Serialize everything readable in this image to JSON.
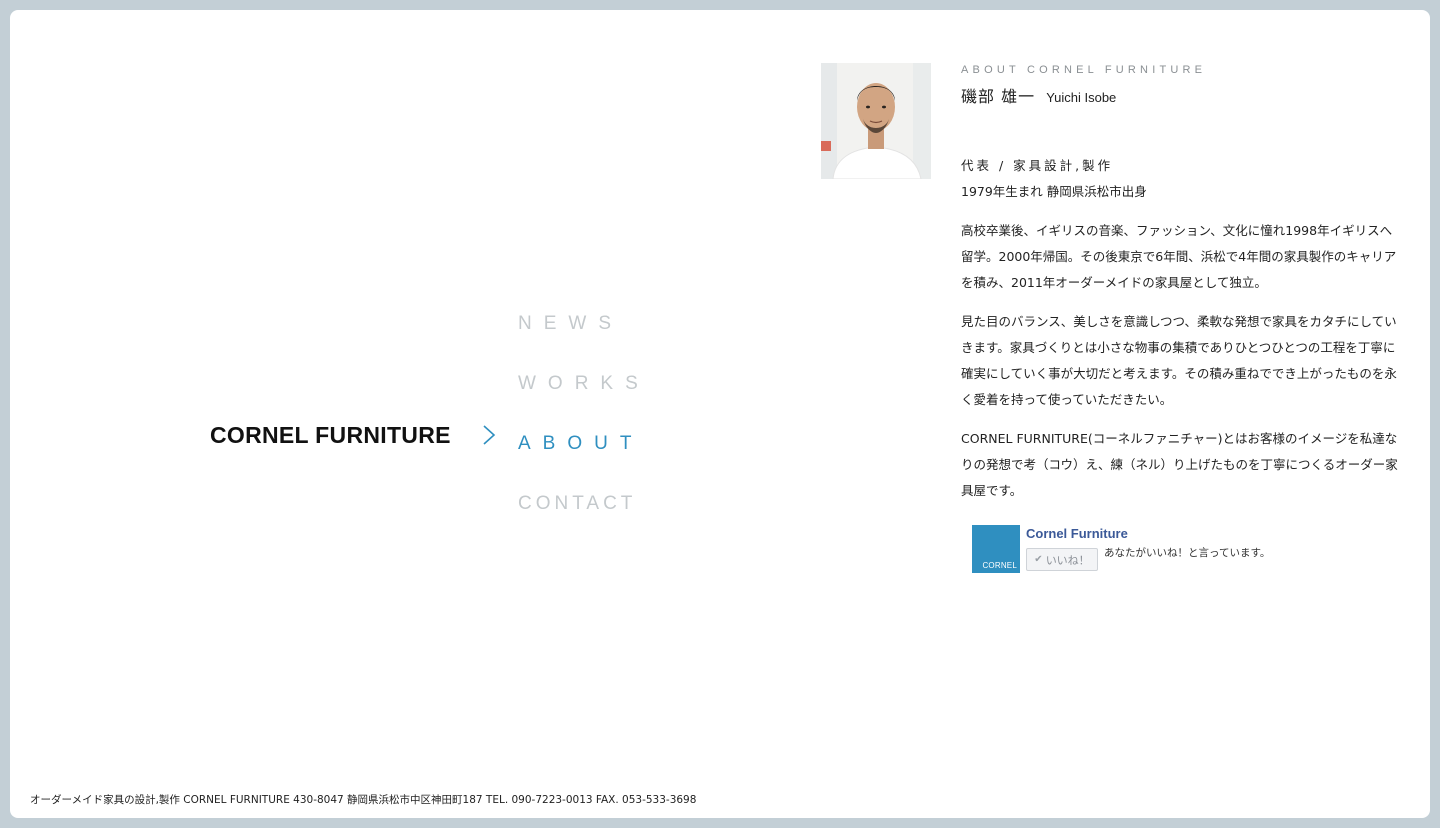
{
  "site": {
    "logo_text": "CORNEL FURNITURE"
  },
  "nav": {
    "items": [
      {
        "label": "NEWS",
        "active": false
      },
      {
        "label": "WORKS",
        "active": false
      },
      {
        "label": "ABOUT",
        "active": true
      },
      {
        "label": "CONTACT",
        "active": false
      }
    ]
  },
  "about": {
    "section_label": "ABOUT CORNEL FURNITURE",
    "name_ja": "磯部 雄一",
    "name_en": "Yuichi Isobe",
    "role": "代表 / 家具設計,製作",
    "origin": "1979年生まれ 静岡県浜松市出身",
    "paragraphs": [
      "高校卒業後、イギリスの音楽、ファッション、文化に憧れ1998年イギリスへ留学。2000年帰国。その後東京で6年間、浜松で4年間の家具製作のキャリアを積み、2011年オーダーメイドの家具屋として独立。",
      "見た目のバランス、美しさを意識しつつ、柔軟な発想で家具をカタチにしていきます。家具づくりとは小さな物事の集積でありひとつひとつの工程を丁寧に確実にしていく事が大切だと考えます。その積み重ねででき上がったものを永く愛着を持って使っていただきたい。",
      "CORNEL FURNITURE(コーネルファニチャー)とはお客様のイメージを私達なりの発想で考（コウ）え、練（ネル）り上げたものを丁寧につくるオーダー家具屋です。"
    ]
  },
  "facebook": {
    "logo_text": "CORNEL",
    "page_name": "Cornel Furniture",
    "like_label": "いいね！",
    "status_text": "あなたがいいね！と言っています。"
  },
  "footer": {
    "text": "オーダーメイド家具の設計,製作 CORNEL FURNITURE 430-8047 静岡県浜松市中区神田町187 TEL. 090-7223-0013 FAX. 053-533-3698"
  },
  "colors": {
    "accent": "#2f8fc0",
    "nav_inactive": "#c4c9cc",
    "outer_background": "#c3cfd6",
    "facebook_blue": "#3b5998"
  }
}
